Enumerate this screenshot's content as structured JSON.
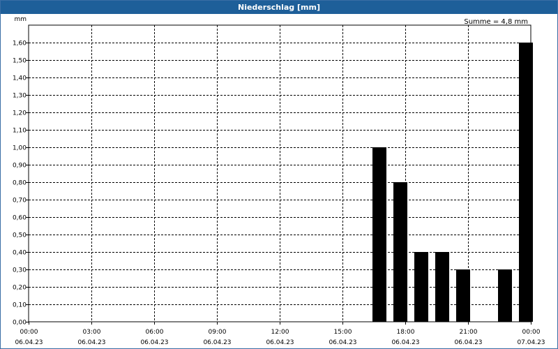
{
  "window": {
    "title": "Niederschlag [mm]"
  },
  "summary": "Summe = 4,8 mm",
  "chart_data": {
    "type": "bar",
    "title": "Niederschlag [mm]",
    "ylabel": "mm",
    "ylim": [
      0,
      1.7
    ],
    "yticks": [
      "0,00",
      "0,10",
      "0,20",
      "0,30",
      "0,40",
      "0,50",
      "0,60",
      "0,70",
      "0,80",
      "0,90",
      "1,00",
      "1,10",
      "1,20",
      "1,30",
      "1,40",
      "1,50",
      "1,60"
    ],
    "xlim_hours": [
      0,
      24
    ],
    "xticks": [
      {
        "time": "00:00",
        "date": "06.04.23"
      },
      {
        "time": "03:00",
        "date": "06.04.23"
      },
      {
        "time": "06:00",
        "date": "06.04.23"
      },
      {
        "time": "09:00",
        "date": "06.04.23"
      },
      {
        "time": "12:00",
        "date": "06.04.23"
      },
      {
        "time": "15:00",
        "date": "06.04.23"
      },
      {
        "time": "18:00",
        "date": "06.04.23"
      },
      {
        "time": "21:00",
        "date": "06.04.23"
      },
      {
        "time": "00:00",
        "date": "07.04.23"
      }
    ],
    "grid": true,
    "bar_color": "#000000",
    "bars": [
      {
        "time": "16:45",
        "value": 1.0
      },
      {
        "time": "17:45",
        "value": 0.8
      },
      {
        "time": "18:45",
        "value": 0.4
      },
      {
        "time": "19:45",
        "value": 0.4
      },
      {
        "time": "20:45",
        "value": 0.3
      },
      {
        "time": "21:45",
        "value": 0
      },
      {
        "time": "22:45",
        "value": 0.3
      },
      {
        "time": "23:45",
        "value": 1.6
      }
    ]
  }
}
